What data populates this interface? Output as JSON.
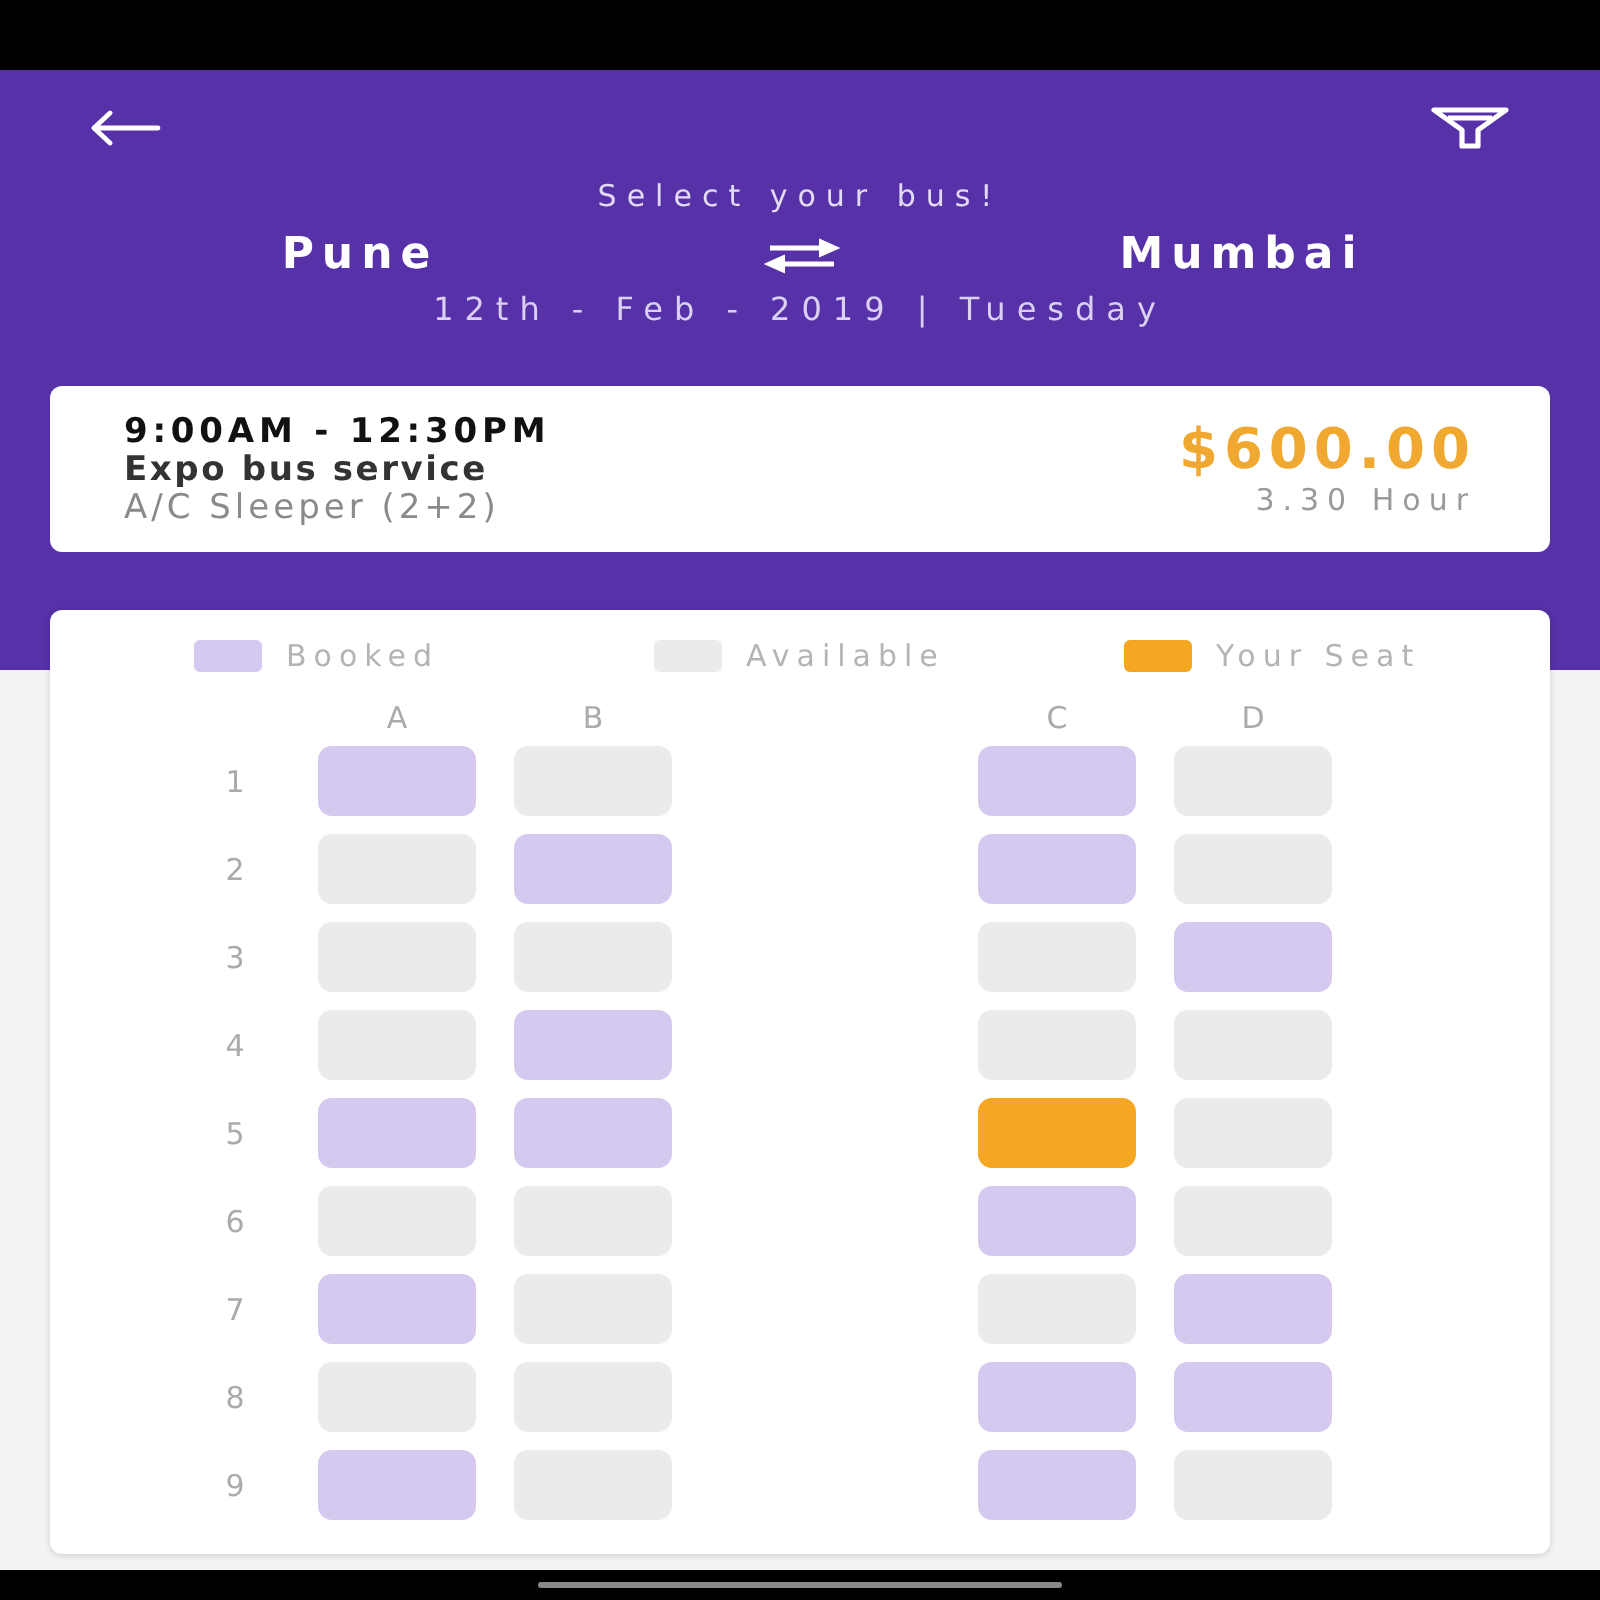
{
  "header": {
    "title": "Select your bus!",
    "from": "Pune",
    "to": "Mumbai",
    "date": "12th - Feb - 2019 | Tuesday"
  },
  "bus": {
    "time": "9:00AM - 12:30PM",
    "operator": "Expo bus service",
    "type": "A/C Sleeper (2+2)",
    "price": "$600.00",
    "duration": "3.30 Hour"
  },
  "seat_map": {
    "legend": [
      {
        "kind": "booked",
        "label": "Booked"
      },
      {
        "kind": "available",
        "label": "Available"
      },
      {
        "kind": "yours",
        "label": "Your Seat"
      }
    ],
    "columns": [
      "A",
      "B",
      "C",
      "D"
    ],
    "rows": [
      {
        "label": "1",
        "seats": [
          {
            "booked": true,
            "selected": false
          },
          {
            "booked": false,
            "selected": false
          },
          {
            "booked": true,
            "selected": false
          },
          {
            "booked": false,
            "selected": false
          }
        ]
      },
      {
        "label": "2",
        "seats": [
          {
            "booked": false,
            "selected": false
          },
          {
            "booked": true,
            "selected": false
          },
          {
            "booked": true,
            "selected": false
          },
          {
            "booked": false,
            "selected": false
          }
        ]
      },
      {
        "label": "3",
        "seats": [
          {
            "booked": false,
            "selected": false
          },
          {
            "booked": false,
            "selected": false
          },
          {
            "booked": false,
            "selected": false
          },
          {
            "booked": true,
            "selected": false
          }
        ]
      },
      {
        "label": "4",
        "seats": [
          {
            "booked": false,
            "selected": false
          },
          {
            "booked": true,
            "selected": false
          },
          {
            "booked": false,
            "selected": false
          },
          {
            "booked": false,
            "selected": false
          }
        ]
      },
      {
        "label": "5",
        "seats": [
          {
            "booked": true,
            "selected": false
          },
          {
            "booked": true,
            "selected": false
          },
          {
            "booked": false,
            "selected": true
          },
          {
            "booked": false,
            "selected": false
          }
        ]
      },
      {
        "label": "6",
        "seats": [
          {
            "booked": false,
            "selected": false
          },
          {
            "booked": false,
            "selected": false
          },
          {
            "booked": true,
            "selected": false
          },
          {
            "booked": false,
            "selected": false
          }
        ]
      },
      {
        "label": "7",
        "seats": [
          {
            "booked": true,
            "selected": false
          },
          {
            "booked": false,
            "selected": false
          },
          {
            "booked": false,
            "selected": false
          },
          {
            "booked": true,
            "selected": false
          }
        ]
      },
      {
        "label": "8",
        "seats": [
          {
            "booked": false,
            "selected": false
          },
          {
            "booked": false,
            "selected": false
          },
          {
            "booked": true,
            "selected": false
          },
          {
            "booked": true,
            "selected": false
          }
        ]
      },
      {
        "label": "9",
        "seats": [
          {
            "booked": true,
            "selected": false
          },
          {
            "booked": false,
            "selected": false
          },
          {
            "booked": true,
            "selected": false
          },
          {
            "booked": false,
            "selected": false
          }
        ]
      }
    ]
  }
}
